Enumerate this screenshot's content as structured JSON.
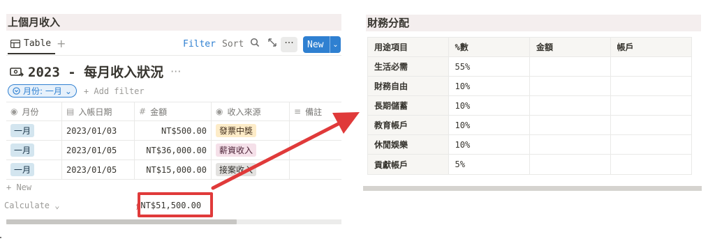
{
  "left": {
    "header": "上個月收入",
    "toolbar": {
      "tab_label": "Table",
      "filter_label": "Filter",
      "sort_label": "Sort",
      "more_label": "···",
      "new_label": "New"
    },
    "db_title": "2023 - 每月收入狀況",
    "title_dots": "···",
    "filter_pill": "月份: 一月",
    "add_filter": "+ Add filter",
    "columns": [
      {
        "label": "月份",
        "icon": "select-icon"
      },
      {
        "label": "入帳日期",
        "icon": "calendar-icon"
      },
      {
        "label": "金額",
        "icon": "number-icon"
      },
      {
        "label": "收入來源",
        "icon": "select-icon"
      },
      {
        "label": "備註",
        "icon": "text-icon"
      }
    ],
    "rows": [
      {
        "month": "一月",
        "date": "2023/01/03",
        "amount": "NT$500.00",
        "source": "發票中獎",
        "note": ""
      },
      {
        "month": "一月",
        "date": "2023/01/05",
        "amount": "NT$36,000.00",
        "source": "薪資收入",
        "note": ""
      },
      {
        "month": "一月",
        "date": "2023/01/05",
        "amount": "NT$15,000.00",
        "source": "接案收入",
        "note": ""
      }
    ],
    "new_row": "+ New",
    "calculate": "Calculate",
    "sum_value": "NT$51,500.00"
  },
  "right": {
    "header": "財務分配",
    "columns": [
      "用途項目",
      "%數",
      "金額",
      "帳戶"
    ],
    "rows": [
      {
        "item": "生活必需",
        "percent": "55%",
        "amount": "",
        "account": ""
      },
      {
        "item": "財務自由",
        "percent": "10%",
        "amount": "",
        "account": ""
      },
      {
        "item": "長期儲蓄",
        "percent": "10%",
        "amount": "",
        "account": ""
      },
      {
        "item": "教育帳戶",
        "percent": "10%",
        "amount": "",
        "account": ""
      },
      {
        "item": "休閒娛樂",
        "percent": "10%",
        "amount": "",
        "account": ""
      },
      {
        "item": "貢獻帳戶",
        "percent": "5%",
        "amount": "",
        "account": ""
      }
    ]
  },
  "colors": {
    "accent": "#2f80d1",
    "header_bg": "#f4eeee",
    "annotation_red": "#e03a3a"
  }
}
